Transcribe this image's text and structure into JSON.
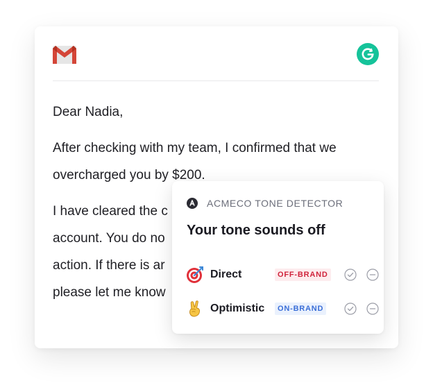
{
  "email": {
    "greeting": "Dear Nadia,",
    "paragraph1_line1": "After checking with my team, I confirmed that we",
    "paragraph1_line2": "overcharged you by $200.",
    "paragraph2_line1": "I have cleared the c",
    "paragraph2_line2": "account. You do no",
    "paragraph2_line3": "action. If there is ar",
    "paragraph2_line4": "please let me know"
  },
  "tone_detector": {
    "label": "ACMECO TONE DETECTOR",
    "title": "Your tone sounds off",
    "tones": [
      {
        "emoji_icon": "direct-hit-target-icon",
        "name": "Direct",
        "badge": "OFF-BRAND",
        "badge_color": "#d0243c"
      },
      {
        "emoji_icon": "victory-hand-icon",
        "name": "Optimistic",
        "badge": "ON-BRAND",
        "badge_color": "#3b6fd8"
      }
    ]
  },
  "colors": {
    "grammarly_green": "#15c39a",
    "gmail_red": "#d44638",
    "off_brand": "#d0243c",
    "on_brand": "#3b6fd8"
  }
}
